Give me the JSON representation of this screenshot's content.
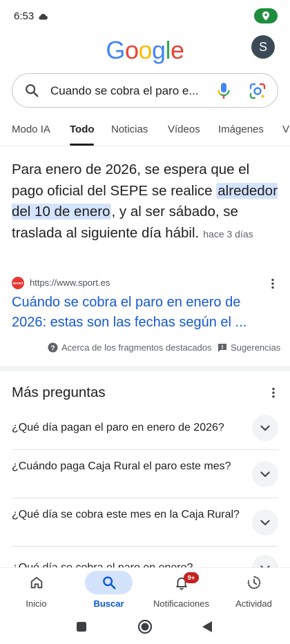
{
  "status_bar": {
    "time": "6:53"
  },
  "header": {
    "logo_letters": [
      {
        "ch": "G",
        "color": "#4285F4"
      },
      {
        "ch": "o",
        "color": "#EA4335"
      },
      {
        "ch": "o",
        "color": "#FBBC05"
      },
      {
        "ch": "g",
        "color": "#4285F4"
      },
      {
        "ch": "l",
        "color": "#34A853"
      },
      {
        "ch": "e",
        "color": "#EA4335"
      }
    ],
    "avatar_letter": "S"
  },
  "search": {
    "query": "Cuando se cobra el paro e..."
  },
  "tabs": [
    "Modo IA",
    "Todo",
    "Noticias",
    "Vídeos",
    "Imágenes",
    "V"
  ],
  "snippet": {
    "before": "Para enero de 2026, se espera que el pago oficial del SEPE se realice ",
    "highlight": "alrededor del 10 de enero",
    "after": ", y al ser sábado, se traslada al siguiente día hábil.",
    "age": "hace 3 días"
  },
  "source": {
    "favicon_text": "SPORT",
    "url": "https://www.sport.es",
    "title": "Cuándo se cobra el paro en enero de 2026: estas son las fechas según el ..."
  },
  "featured_footer": {
    "about": "Acerca de los fragmentos destacados",
    "feedback": "Sugerencias"
  },
  "paa": {
    "title": "Más preguntas",
    "questions": [
      "¿Qué día pagan el paro en enero de 2026?",
      "¿Cuándo paga Caja Rural el paro este mes?",
      "¿Qué día se cobra este mes en la Caja Rural?",
      "¿Qué día se cobra el paro en enero?"
    ]
  },
  "bottom_nav": {
    "items": [
      "Inicio",
      "Buscar",
      "Notificaciones",
      "Actividad"
    ],
    "badge": "9+"
  },
  "colors": {
    "accent": "#0b57d0",
    "link": "#1558d6",
    "highlight": "#d3e3fd",
    "location_pill": "#1e8e3e",
    "badge": "#c5221f"
  }
}
